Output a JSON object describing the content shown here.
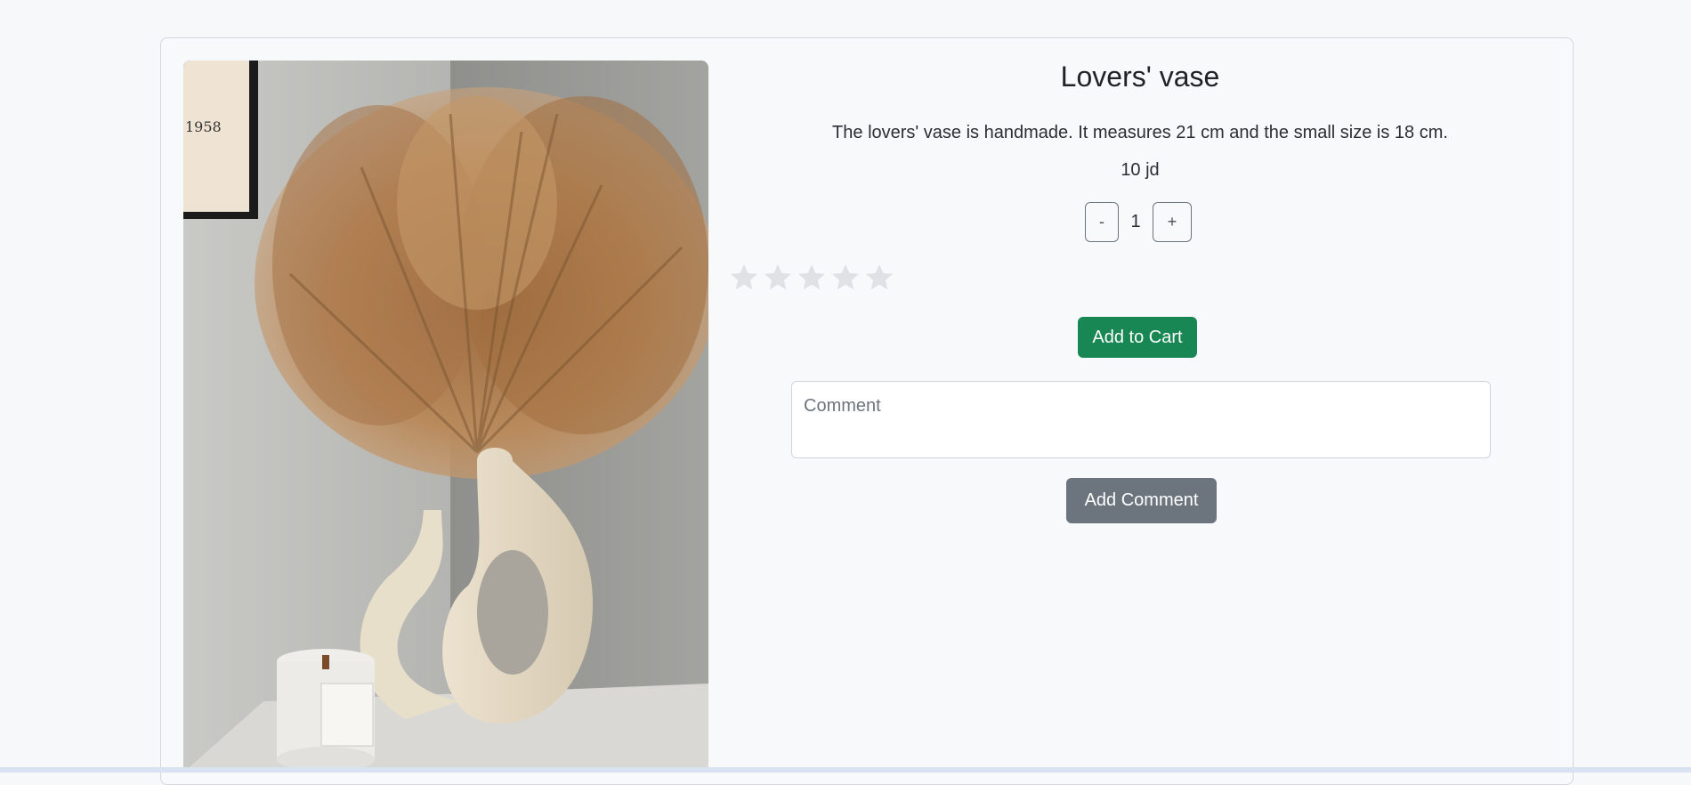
{
  "product": {
    "title": "Lovers' vase",
    "description": "The lovers' vase is handmade. It measures 21 cm and the small size is 18 cm.",
    "price": "10 jd",
    "image_alt": "Lovers' vase with dried pampas grass",
    "frame_text": "1958"
  },
  "quantity": {
    "decrement_label": "-",
    "value": "1",
    "increment_label": "+"
  },
  "rating": {
    "max": 5,
    "value": 0,
    "star_icon": "star-icon",
    "empty_color": "#e0e1e4"
  },
  "actions": {
    "add_to_cart_label": "Add to Cart",
    "add_comment_label": "Add Comment"
  },
  "comment": {
    "placeholder": "Comment",
    "value": ""
  },
  "colors": {
    "success": "#198754",
    "secondary": "#6c757d",
    "background": "#f6f8fa"
  }
}
